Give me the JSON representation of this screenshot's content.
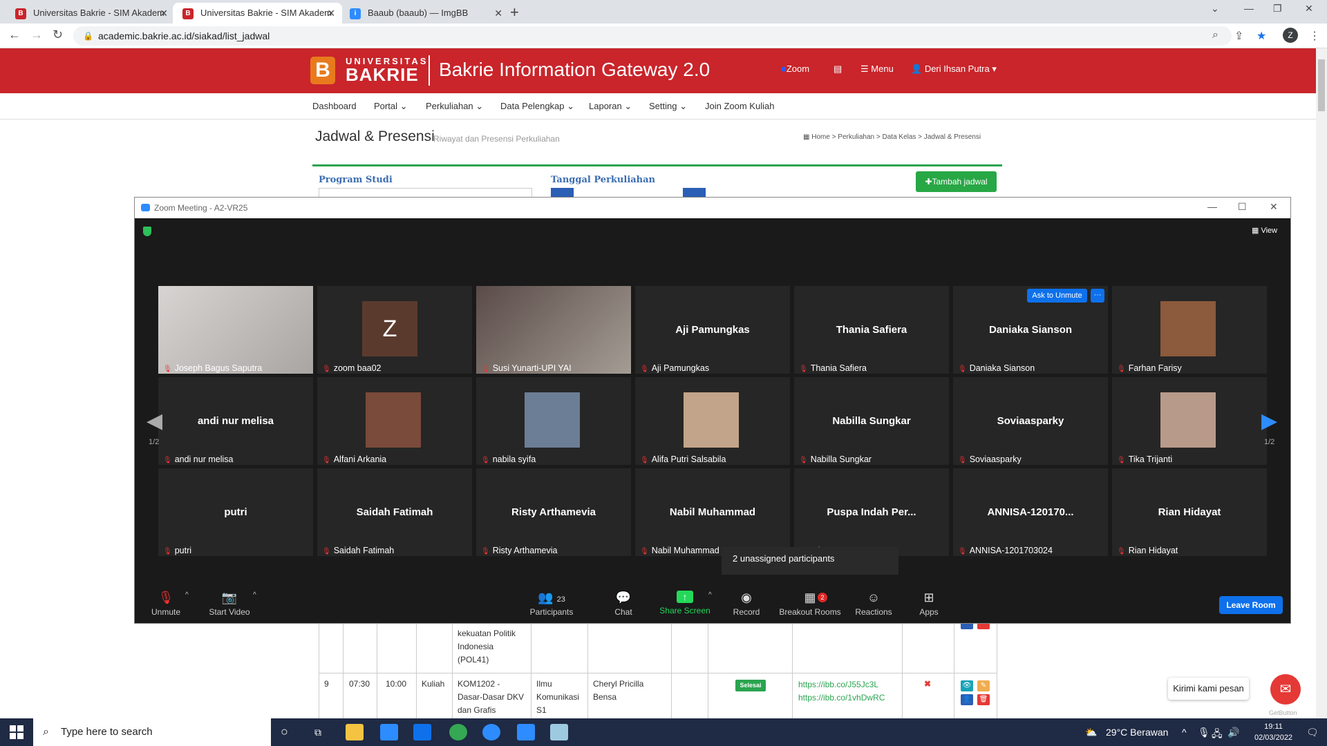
{
  "browser": {
    "tabs": [
      {
        "title": "Universitas Bakrie - SIM Akadem",
        "icon": "bakrie-favicon"
      },
      {
        "title": "Universitas Bakrie - SIM Akadem",
        "icon": "bakrie-favicon"
      },
      {
        "title": "Baaub (baaub) — ImgBB",
        "icon": "imgbb-favicon"
      }
    ],
    "url": "academic.bakrie.ac.id/siakad/list_jadwal",
    "profile_initial": "Z"
  },
  "site": {
    "logo_top": "UNIVERSITAS",
    "logo_bottom": "BAKRIE",
    "logo_letter": "B",
    "gateway_title": "Bakrie Information Gateway 2.0",
    "zoom_link": "Zoom",
    "menu_link": "Menu",
    "user_name": "Deri Ihsan Putra",
    "menu": [
      "Dashboard",
      "Portal",
      "Perkuliahan",
      "Data Pelengkap",
      "Laporan",
      "Setting",
      "Join Zoom Kuliah"
    ],
    "page_title": "Jadwal & Presensi",
    "page_subtitle": "Riwayat dan Presensi Perkuliahan",
    "breadcrumb": "Home  >  Perkuliahan  >  Data Kelas  >  Jadwal & Presensi",
    "program_studi_label": "Program Studi",
    "tanggal_label": "Tanggal Perkuliahan",
    "add_button": "Tambah jadwal"
  },
  "table": {
    "partial_row": [
      "kekuatan Politik",
      "Indonesia",
      "(POL41)"
    ],
    "row": {
      "no": "9",
      "start": "07:30",
      "end": "10:00",
      "type": "Kuliah",
      "course": [
        "KOM1202 -",
        "Dasar-Dasar DKV",
        "dan Grafis"
      ],
      "prodi": [
        "Ilmu",
        "Komunikasi",
        "S1"
      ],
      "lecturer": [
        "Cheryl Pricilla",
        "Bensa"
      ],
      "status": "Selesai",
      "links": [
        "https://ibb.co/J55Jc3L",
        "https://ibb.co/1vhDwRC"
      ]
    }
  },
  "chat_widget": {
    "label": "Kirimi kami pesan",
    "brand": "GetButton"
  },
  "zoom": {
    "window_title": "Zoom Meeting - A2-VR25",
    "view_label": "View",
    "page_indicator": "1/2",
    "ask_to_unmute": "Ask to Unmute",
    "tooltip": "2 unassigned participants",
    "participants": [
      {
        "name": "Joseph Bagus Saputra",
        "display": "",
        "type": "video"
      },
      {
        "name": "zoom baa02",
        "display": "Z",
        "type": "avatar-letter"
      },
      {
        "name": "Susi Yunarti-UPI YAI",
        "display": "",
        "type": "video"
      },
      {
        "name": "Aji Pamungkas",
        "display": "Aji Pamungkas",
        "type": "name"
      },
      {
        "name": "Thania Safiera",
        "display": "Thania Safiera",
        "type": "name"
      },
      {
        "name": "Daniaka Sianson",
        "display": "Daniaka Sianson",
        "type": "name"
      },
      {
        "name": "Farhan Farisy",
        "display": "",
        "type": "photo"
      },
      {
        "name": "andi nur melisa",
        "display": "andi nur melisa",
        "type": "name"
      },
      {
        "name": "Alfani Arkania",
        "display": "",
        "type": "photo"
      },
      {
        "name": "nabila syifa",
        "display": "",
        "type": "photo"
      },
      {
        "name": "Alifa Putri Salsabila",
        "display": "",
        "type": "photo"
      },
      {
        "name": "Nabilla Sungkar",
        "display": "Nabilla Sungkar",
        "type": "name"
      },
      {
        "name": "Soviaasparky",
        "display": "Soviaasparky",
        "type": "name"
      },
      {
        "name": "Tika Trijanti",
        "display": "",
        "type": "photo"
      },
      {
        "name": "putri",
        "display": "putri",
        "type": "name"
      },
      {
        "name": "Saidah Fatimah",
        "display": "Saidah Fatimah",
        "type": "name"
      },
      {
        "name": "Risty Arthamevia",
        "display": "Risty Arthamevia",
        "type": "name"
      },
      {
        "name": "Nabil Muhammad",
        "display": "Nabil Muhammad",
        "type": "name"
      },
      {
        "name": "ari",
        "display": "Puspa  Indah  Per...",
        "type": "name"
      },
      {
        "name": "ANNISA-1201703024",
        "display": "ANNISA-120170...",
        "type": "name"
      },
      {
        "name": "Rian Hidayat",
        "display": "Rian Hidayat",
        "type": "name"
      }
    ],
    "controls": {
      "unmute": "Unmute",
      "start_video": "Start Video",
      "participants": "Participants",
      "participant_count": "23",
      "chat": "Chat",
      "share_screen": "Share Screen",
      "record": "Record",
      "breakout_rooms": "Breakout Rooms",
      "breakout_count": "2",
      "reactions": "Reactions",
      "apps": "Apps",
      "leave_room": "Leave Room"
    }
  },
  "taskbar": {
    "search_placeholder": "Type here to search",
    "weather": "29°C  Berawan",
    "time": "19:11",
    "date": "02/03/2022"
  }
}
